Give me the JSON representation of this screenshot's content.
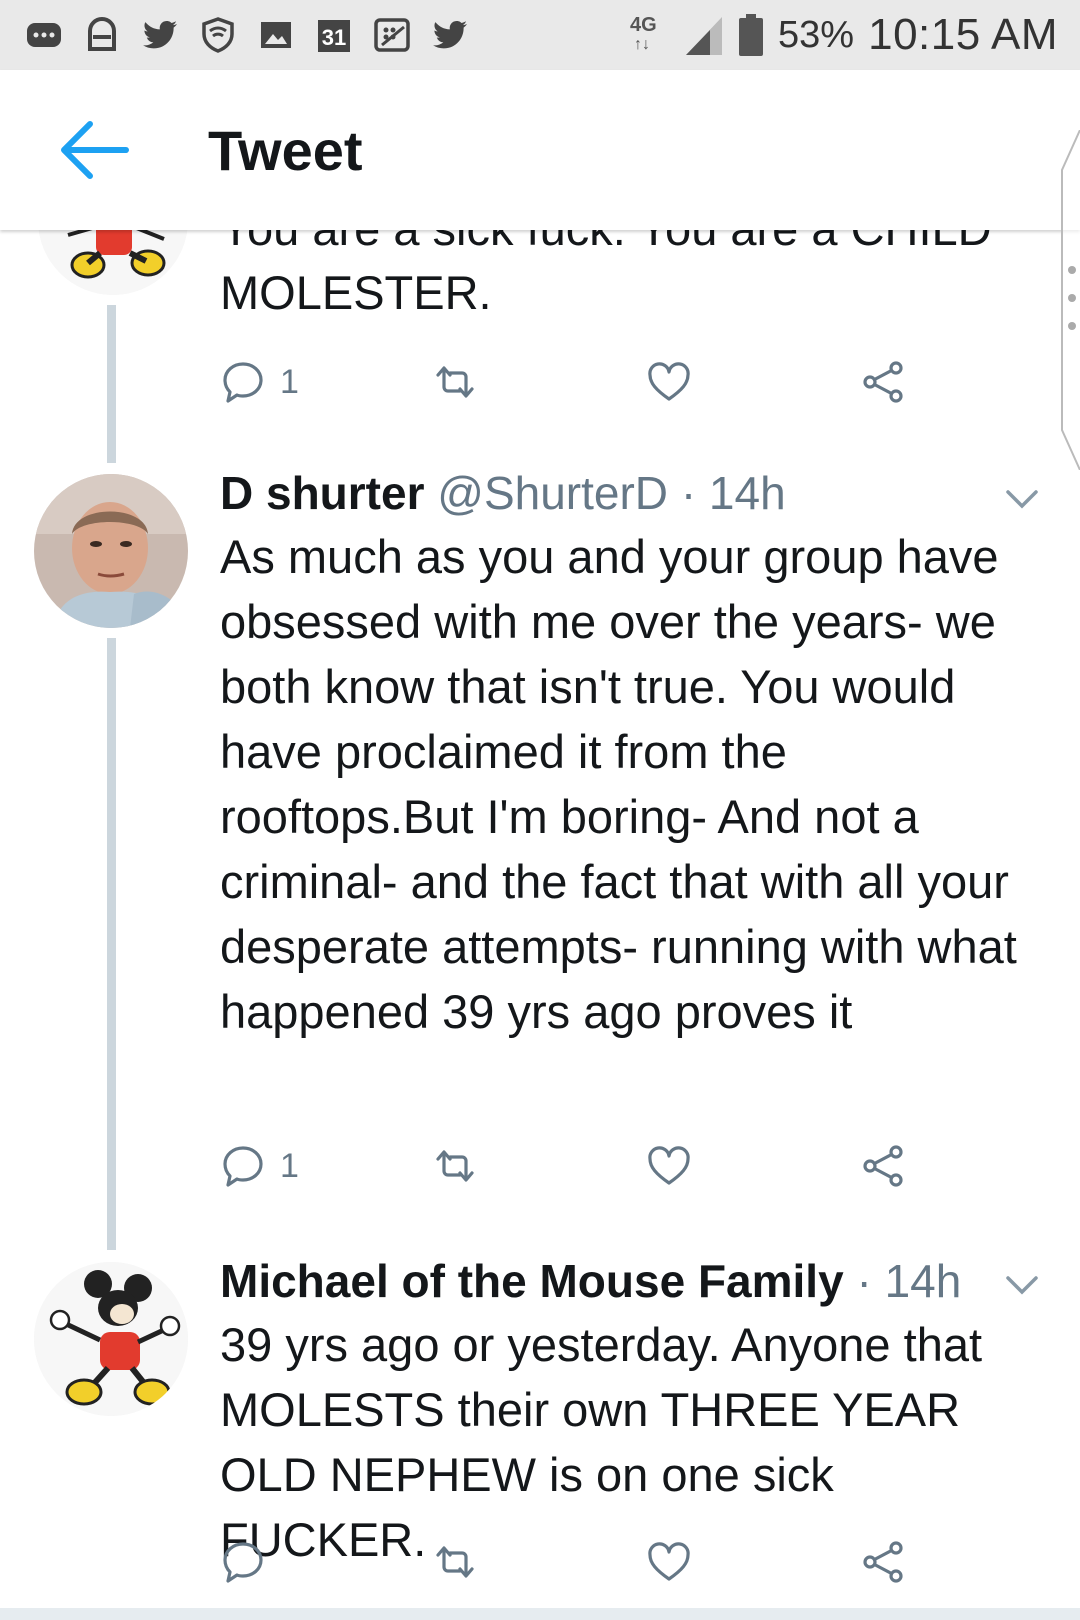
{
  "status_bar": {
    "calendar_day": "31",
    "network": "4G",
    "battery_percent": "53%",
    "time": "10:15 AM",
    "icons": [
      "messages-icon",
      "lock-icon",
      "twitter-bird-icon",
      "shield-icon",
      "gallery-icon",
      "calendar-icon",
      "blackberry-icon",
      "twitter-bird-icon",
      "network-4g-icon",
      "signal-icon",
      "battery-icon"
    ]
  },
  "header": {
    "title": "Tweet",
    "back_icon": "arrow-left-icon"
  },
  "colors": {
    "twitter_blue": "#1da1f2",
    "text_primary": "#14171a",
    "text_secondary": "#657786",
    "thread_line": "#ccd6dd",
    "statusbar_bg": "#e9e9e9"
  },
  "tweets": [
    {
      "body_partial_top": "You are a sick fuck. You are a CHILD",
      "body": "MOLESTER.",
      "avatar": "mickey-mouse-avatar",
      "reply_count": "1",
      "retweet_count": "",
      "like_count": ""
    },
    {
      "name": "D shurter",
      "handle": "@ShurterD",
      "separator": "·",
      "time": "14h",
      "avatar": "man-selfie-avatar",
      "body": "As much as you and your group have obsessed with me over the years- we both know that isn't true. You would have proclaimed it from the rooftops.But I'm boring- And not a criminal- and the fact that with all your desperate attempts- running with what happened 39 yrs ago proves it",
      "reply_count": "1",
      "retweet_count": "",
      "like_count": ""
    },
    {
      "name": "Michael of the Mouse Family",
      "handle": "",
      "separator": "·",
      "time": "14h",
      "avatar": "mickey-mouse-avatar",
      "body": "39 yrs ago or yesterday. Anyone that MOLESTS their own THREE YEAR OLD NEPHEW is on one sick FUCKER.",
      "reply_count": "",
      "retweet_count": "",
      "like_count": ""
    }
  ]
}
